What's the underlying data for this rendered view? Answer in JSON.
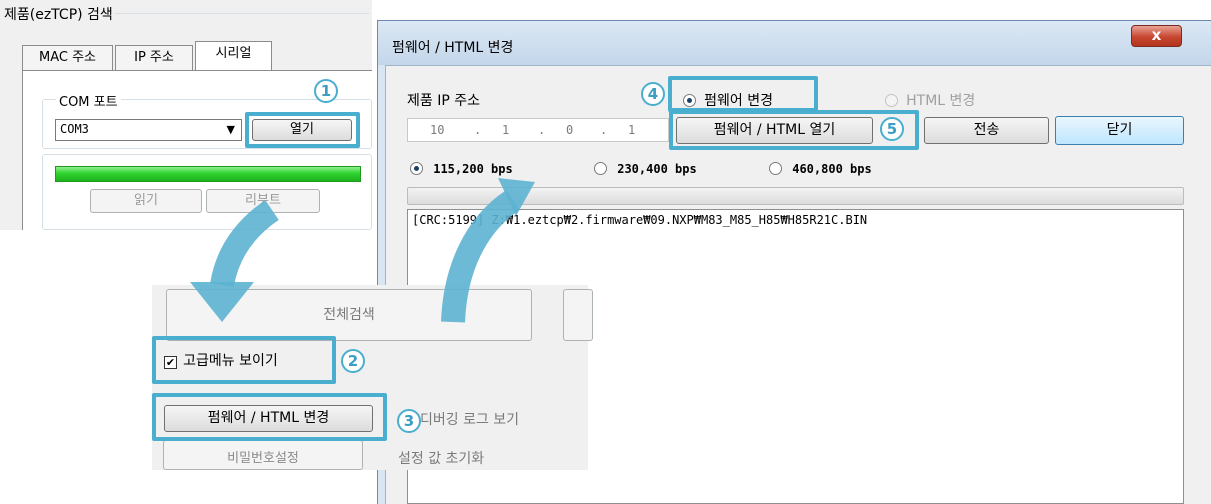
{
  "search_panel": {
    "group_title": "제품(ezTCP) 검색",
    "tabs": [
      {
        "label": "MAC 주소",
        "active": false
      },
      {
        "label": "IP 주소",
        "active": false
      },
      {
        "label": "시리얼",
        "active": true
      }
    ],
    "com_port": {
      "group_label": "COM 포트",
      "selected": "COM3",
      "open_button": "열기"
    },
    "read_button": "읽기",
    "reboot_button": "리부트",
    "progress_fraction": 1.0
  },
  "dialog": {
    "title": "펌웨어 / HTML 변경",
    "close_label": "x",
    "ip_label": "제품 IP 주소",
    "ip_octets": [
      "10",
      "1",
      "0",
      "1"
    ],
    "mode_options": [
      {
        "label": "펌웨어 변경",
        "selected": true,
        "enabled": true
      },
      {
        "label": "HTML 변경",
        "selected": false,
        "enabled": false
      }
    ],
    "open_button": "펌웨어 / HTML 열기",
    "send_button": "전송",
    "close_button": "닫기",
    "baud_options": [
      {
        "label": "115,200 bps",
        "selected": true
      },
      {
        "label": "230,400 bps",
        "selected": false
      },
      {
        "label": "460,800 bps",
        "selected": false
      }
    ],
    "progress_fraction": 0,
    "log_text": "[CRC:5199] Z:₩1.eztcp₩2.firmware₩09.NXP₩M83_M85_H85₩H85R21C.BIN"
  },
  "advanced_panel": {
    "search_all_button": "전체검색",
    "advanced_menu_checkbox": {
      "label": "고급메뉴 보이기",
      "checked": true
    },
    "firmware_button": "펌웨어 / HTML 변경",
    "debug_log_button": "디버깅 로그 보기",
    "password_button": "비밀번호설정",
    "reset_button": "설정 값 초기화"
  },
  "callouts": [
    "1",
    "2",
    "3",
    "4",
    "5"
  ],
  "colors": {
    "highlight": "#4aaecf",
    "arrow": "#5db3d2",
    "progress_green": "#2fd32f",
    "dialog_frame": "#d8e6f3",
    "close_red": "#c7462f"
  },
  "icons": [
    "dropdown-arrow-icon",
    "close-x-icon",
    "checkbox-checked-icon",
    "curved-arrow-icon"
  ]
}
